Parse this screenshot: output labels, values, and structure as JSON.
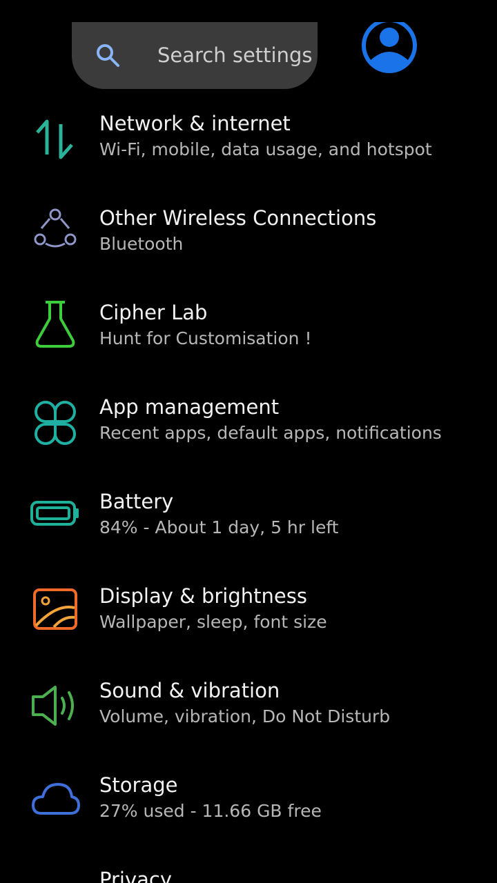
{
  "search": {
    "placeholder": "Search settings",
    "icon": "search-icon"
  },
  "account": {
    "icon": "account-circle-icon",
    "color": "#1a73e8"
  },
  "items": [
    {
      "title": "Network & internet",
      "subtitle": "Wi-Fi, mobile, data usage, and hotspot",
      "icon": "network-arrows-icon",
      "color": "#2bb39a"
    },
    {
      "title": "Other Wireless Connections",
      "subtitle": "Bluetooth",
      "icon": "connections-nodes-icon",
      "color": "#8f96c8"
    },
    {
      "title": "Cipher Lab",
      "subtitle": "Hunt for Customisation !",
      "icon": "flask-icon",
      "color": "#3ccc3c"
    },
    {
      "title": "App management",
      "subtitle": "Recent apps, default apps, notifications",
      "icon": "app-clover-icon",
      "color": "#1fb0a3"
    },
    {
      "title": "Battery",
      "subtitle": "84% - About 1 day, 5 hr left",
      "icon": "battery-icon",
      "color": "#1fb09a"
    },
    {
      "title": "Display & brightness",
      "subtitle": "Wallpaper, sleep, font size",
      "icon": "display-image-icon",
      "color": "#f06a2a"
    },
    {
      "title": "Sound & vibration",
      "subtitle": "Volume, vibration, Do Not Disturb",
      "icon": "speaker-icon",
      "color": "#4caf50"
    },
    {
      "title": "Storage",
      "subtitle": "27% used - 11.66 GB free",
      "icon": "cloud-icon",
      "color": "#3f6fd8"
    },
    {
      "title": "Privacy",
      "subtitle": "",
      "icon": "",
      "color": ""
    }
  ]
}
